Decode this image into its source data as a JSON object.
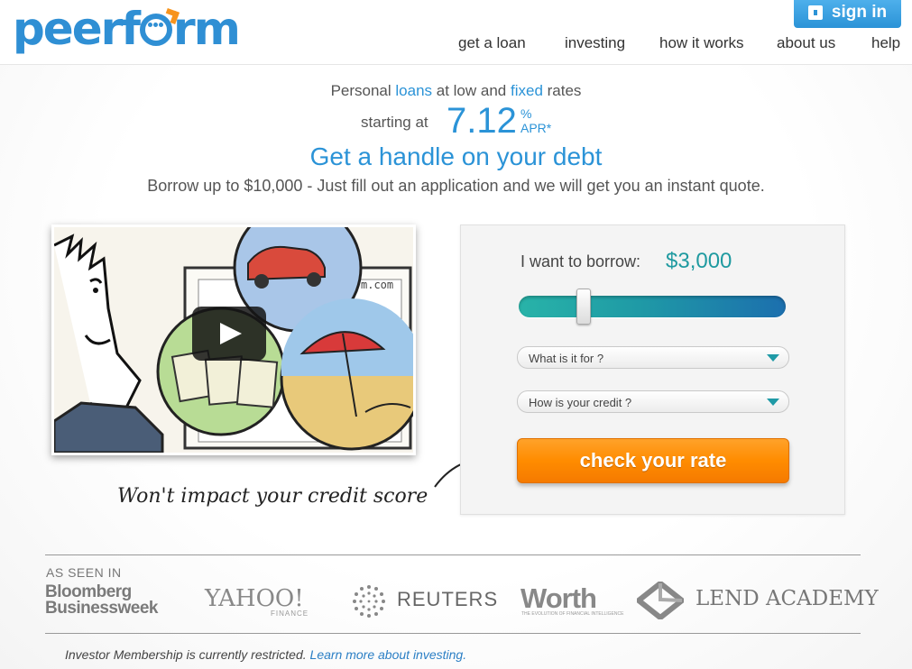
{
  "header": {
    "logo_text": "peerform",
    "signin_label": "sign in",
    "nav": [
      "get a loan",
      "investing",
      "how it works",
      "about us",
      "help"
    ]
  },
  "hero": {
    "line1_part1": "Personal ",
    "line1_loans": "loans",
    "line1_part2": " at low and ",
    "line1_fixed": "fixed",
    "line1_part3": " rates",
    "starting_label": "starting at",
    "rate": "7.12",
    "rate_unit": "%",
    "apr_label": "APR*",
    "headline": "Get a handle on your debt",
    "subline": "Borrow up to $10,000 - Just fill out an application and we will get you an instant quote."
  },
  "video": {
    "illustration_text": "m.com"
  },
  "credit_note": "Won't impact your credit score",
  "form": {
    "borrow_label": "I want to borrow:",
    "borrow_amount": "$3,000",
    "slider_value": 3000,
    "slider_fraction": 0.23,
    "purpose_placeholder": "What is it for ?",
    "credit_placeholder": "How is your credit ?",
    "check_button": "check your rate"
  },
  "press": {
    "heading": "AS SEEN IN",
    "bloomberg_1": "Bloomberg",
    "bloomberg_2": "Businessweek",
    "yahoo": "YAHOO!",
    "yahoo_sub": "FINANCE",
    "reuters": "REUTERS",
    "worth": "Worth",
    "worth_sub": "THE EVOLUTION OF FINANCIAL INTELLIGENCE",
    "lend": "LEND ACADEMY"
  },
  "footer": {
    "note": "Investor Membership is currently restricted. ",
    "link": "Learn more about investing."
  },
  "colors": {
    "brand_blue": "#2b93d7",
    "teal": "#1f9aa6",
    "orange": "#ff8c00"
  },
  "icons": [
    "lock-icon",
    "play-icon",
    "chevron-down-icon",
    "reuters-dots-icon",
    "lend-academy-icon",
    "arrow-icon"
  ]
}
